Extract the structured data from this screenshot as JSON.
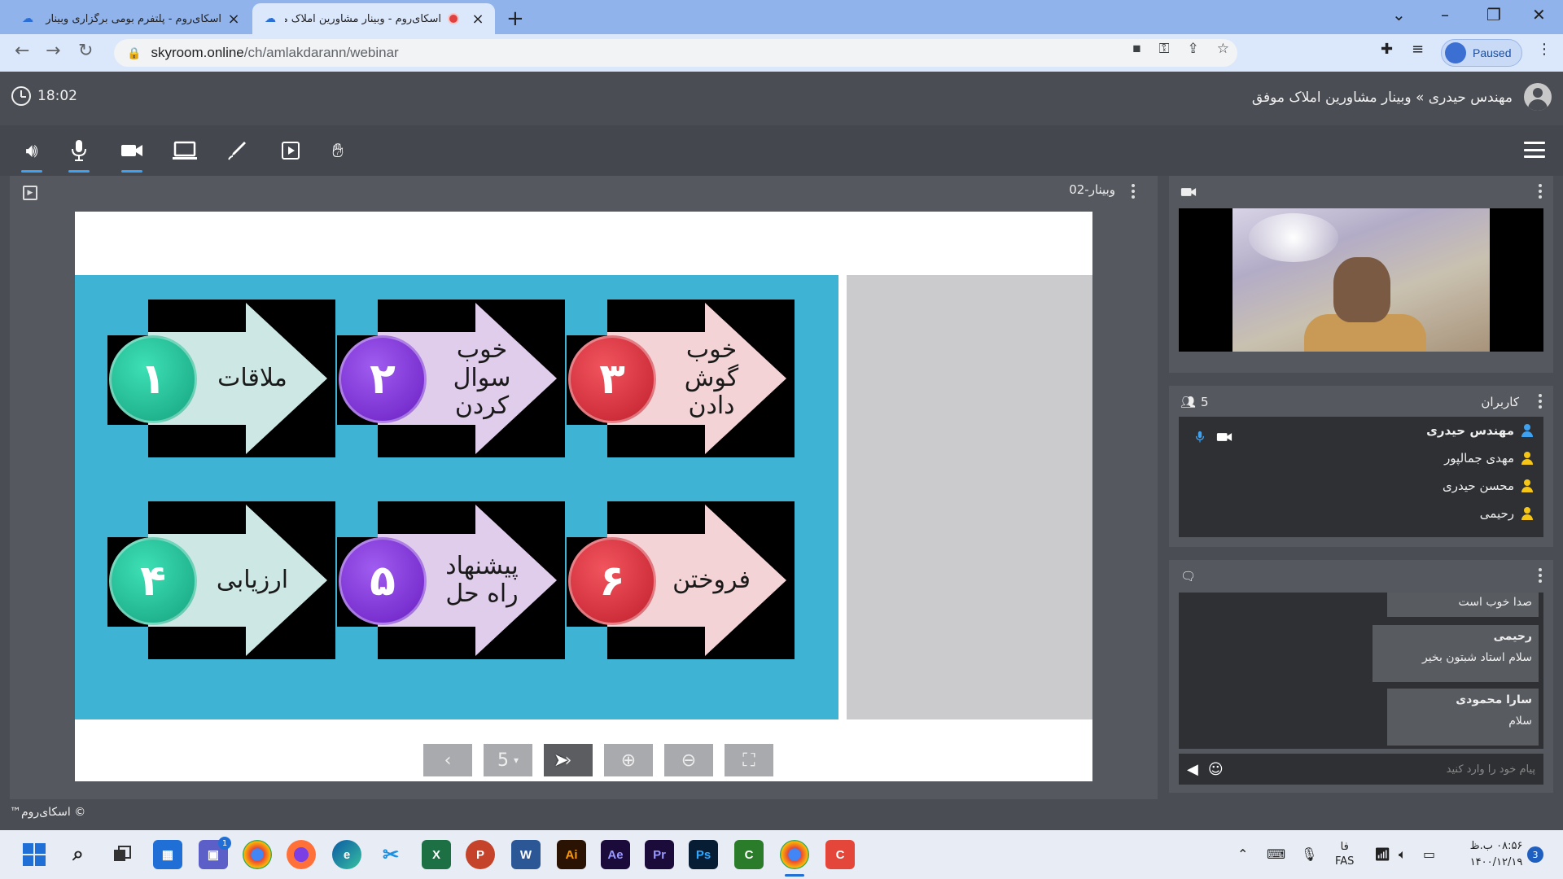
{
  "browser": {
    "tabs": [
      {
        "title": "اسکای‌روم - پلتفرم بومی برگزاری وبینار",
        "active": false
      },
      {
        "title": "اسکای‌روم - وبینار مشاورین املاک موفق",
        "active": true,
        "recording": true
      }
    ],
    "url_host": "skyroom.online",
    "url_path": "/ch/amlakdarann/webinar",
    "profile_status": "Paused"
  },
  "app": {
    "clock": "18:02",
    "room_title": "مهندس حیدری » وبینار مشاورین املاک موفق",
    "toolbar": [
      "speaker-icon",
      "microphone-icon",
      "camera-icon",
      "screen-share-icon",
      "pen-icon",
      "media-icon",
      "raise-hand-icon"
    ]
  },
  "presentation": {
    "file_name": "وبینار-02",
    "steps": [
      {
        "num": "١",
        "label": "ملاقات",
        "color": "teal"
      },
      {
        "num": "٢",
        "label": "خوب سوال کردن",
        "color": "purple"
      },
      {
        "num": "٣",
        "label": "خوب گوش دادن",
        "color": "red"
      },
      {
        "num": "۴",
        "label": "ارزیابی",
        "color": "teal"
      },
      {
        "num": "۵",
        "label": "پیشنهاد راه حل",
        "color": "purple"
      },
      {
        "num": "۶",
        "label": "فروختن",
        "color": "red"
      }
    ],
    "page_select": "5",
    "controls": {
      "prev": "‹",
      "next": "›"
    }
  },
  "users": {
    "count": "5",
    "title": "کاربران",
    "list": [
      {
        "name": "مهندس حیدری",
        "role": "host"
      },
      {
        "name": "مهدی جمالپور",
        "role": "user"
      },
      {
        "name": "محسن حیدری",
        "role": "user"
      },
      {
        "name": "رحیمی",
        "role": "user"
      }
    ]
  },
  "chat": {
    "messages": [
      {
        "author": "",
        "text": "صدا خوب است"
      },
      {
        "author": "رحیمی",
        "text": "سلام استاد شبتون بخیر"
      },
      {
        "author": "سارا محمودی",
        "text": "سلام"
      }
    ],
    "input_placeholder": "پیام خود را وارد کنید"
  },
  "footer": {
    "copyright": "© اسکای‌روم™"
  },
  "taskbar": {
    "lang_top": "فا",
    "lang_bottom": "FAS",
    "time": "۰۸:۵۶ ب.ظ",
    "date": "۱۴۰۰/۱۲/۱۹",
    "notification_count": "3",
    "chat_badge": "1"
  },
  "colors": {
    "accent": "#3fa2f0",
    "slide_bg": "#3fb3d3",
    "teal": "#1fb58c",
    "purple": "#7a2ad0",
    "red": "#d32e38",
    "user_host_icon": "#3fa2f0",
    "user_icon": "#f5c518"
  }
}
